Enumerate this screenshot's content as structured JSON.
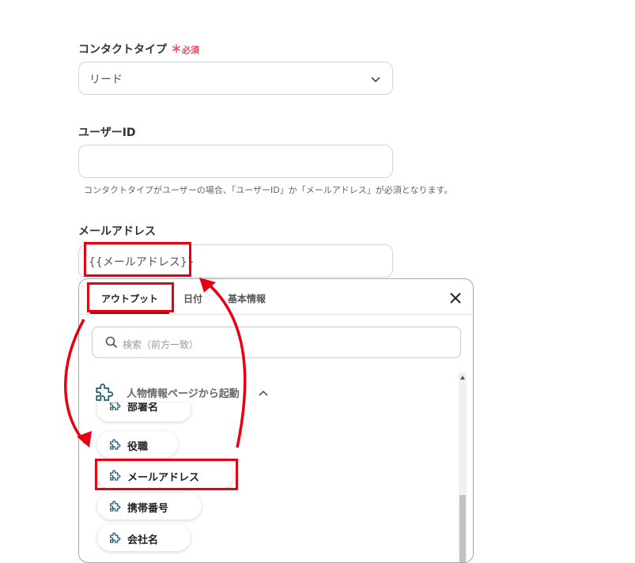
{
  "form": {
    "contact_type": {
      "label": "コンタクトタイプ",
      "required_star": "＊",
      "required_text": "必須",
      "value": "リード"
    },
    "user_id": {
      "label": "ユーザーID",
      "value": "",
      "hint": "コンタクトタイプがユーザーの場合、「ユーザーID」か「メールアドレス」が必須となります。"
    },
    "email": {
      "label": "メールアドレス",
      "value": "{{メールアドレス}}"
    }
  },
  "dropdown": {
    "tabs": [
      {
        "label": "アウトプット",
        "active": true
      },
      {
        "label": "日付",
        "active": false
      },
      {
        "label": "基本情報",
        "active": false
      }
    ],
    "search_placeholder": "検索（前方一致）",
    "group": {
      "label": "人物情報ページから起動",
      "items": [
        {
          "label": "部署名"
        },
        {
          "label": "役職"
        },
        {
          "label": "メールアドレス"
        },
        {
          "label": "携帯番号"
        },
        {
          "label": "会社名"
        }
      ]
    }
  },
  "colors": {
    "accent_red": "#e60012",
    "required": "#e5485f",
    "icon_teal": "#1f5f6b"
  },
  "icons": {
    "select_toggle": "chevron-down-icon",
    "close": "close-icon",
    "search": "search-icon",
    "output_item": "puzzle-icon",
    "group_toggle": "chevron-up-icon"
  }
}
